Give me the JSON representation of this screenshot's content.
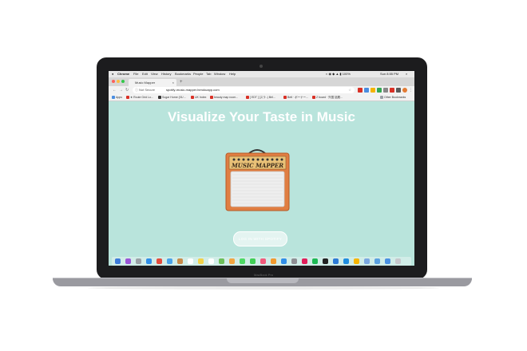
{
  "menubar": {
    "apple": "",
    "items": [
      "Chrome",
      "File",
      "Edit",
      "View",
      "History",
      "Bookmarks",
      "People",
      "Tab",
      "Window",
      "Help"
    ],
    "clock": "Sun 8:55 PM"
  },
  "tabs": [
    {
      "label": "Music Mapper"
    }
  ],
  "addressbar": {
    "secure_label": "Not Secure",
    "url": "spotify-music-mapper.herokuapp.com"
  },
  "bookmarks": {
    "items": [
      "Apps",
      "★ Route Grid Lo...",
      "Sugar Home (01/...",
      "UK Index",
      "beauty map room...",
      "[ EDT ] [スラ..) Bril...",
      "Belt · ボーナー...",
      "Z board · 外国 話題..."
    ],
    "other": "Other Bookmarks"
  },
  "page": {
    "headline": "Visualize Your Taste in Music",
    "amp_brand": "MUSIC MAPPER",
    "login_label": "LOG IN WITH SPOTIFY"
  },
  "laptop": {
    "model": "MacBook Pro"
  },
  "colors": {
    "page_bg": "#b9e4dc",
    "amp_body": "#e07e42",
    "amp_grille": "#eeeeee",
    "amp_panel": "#e9c177"
  },
  "dock": {
    "icons": [
      "finder-icon",
      "siri-icon",
      "launchpad-icon",
      "safari-icon",
      "chrome-icon",
      "mail-icon",
      "contacts-icon",
      "calendar-icon",
      "notes-icon",
      "reminders-icon",
      "maps-icon",
      "photos-icon",
      "messages-icon",
      "facetime-icon",
      "itunes-icon",
      "ibooks-icon",
      "appstore-icon",
      "preferences-icon",
      "slack-icon",
      "spotify-icon",
      "terminal-icon",
      "vscode-icon",
      "xcode-icon",
      "sketch-icon",
      "preview-icon",
      "folder-icon",
      "downloads-icon",
      "trash-icon"
    ],
    "colors": [
      "#3d7ad9",
      "#9a55d6",
      "#9aa0a6",
      "#2f8ee8",
      "#e34b3c",
      "#4aa3ea",
      "#c88b4a",
      "#ffffff",
      "#f2d24a",
      "#ffffff",
      "#6cbf5a",
      "#f2a541",
      "#4cd964",
      "#3fcf55",
      "#f25a7b",
      "#f29a2e",
      "#2f8ee8",
      "#8e8e93",
      "#e01e5a",
      "#1db954",
      "#222222",
      "#2c7ad6",
      "#1f8de0",
      "#f7b500",
      "#7aa7e0",
      "#5aa0e0",
      "#4a90e2",
      "#c7c7cc"
    ]
  }
}
